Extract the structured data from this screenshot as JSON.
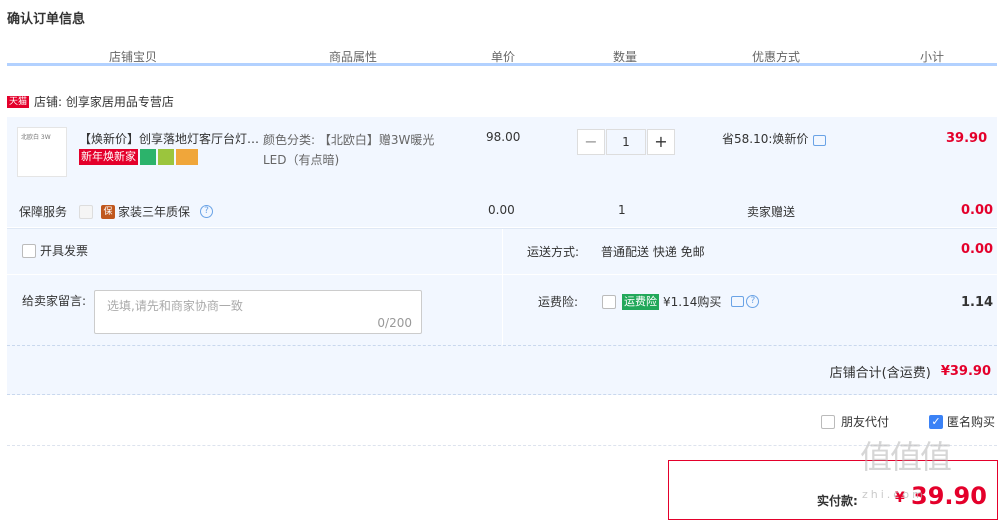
{
  "page_title": "确认订单信息",
  "table_headers": [
    "店铺宝贝",
    "商品属性",
    "单价",
    "数量",
    "优惠方式",
    "小计"
  ],
  "shop": {
    "badge": "天猫",
    "label": "店铺: 创享家居用品专营店"
  },
  "item": {
    "thumb_text": "北欧白 3W",
    "name": "【焕新价】创享落地灯客厅台灯…",
    "tag": "新年焕新家",
    "attr_line1": "颜色分类: 【北欧白】赠3W暖光",
    "attr_line2": "LED（有点暗)",
    "price": "98.00",
    "qty": "1",
    "minus": "−",
    "plus": "+",
    "promo": "省58.10:焕新价",
    "subtotal": "39.90"
  },
  "service": {
    "label": "保障服务",
    "badge": "保",
    "name": "家装三年质保",
    "help": "?",
    "price": "0.00",
    "qty": "1",
    "promo": "卖家赠送",
    "subtotal": "0.00"
  },
  "invoice_label": "开具发票",
  "shipping": {
    "label": "运送方式:",
    "value": "普通配送 快递 免邮",
    "amount": "0.00"
  },
  "message": {
    "label": "给卖家留言:",
    "placeholder": "选填,请先和商家协商一致",
    "counter": "0/200"
  },
  "insurance": {
    "label": "运费险:",
    "tag": "运费险",
    "value": "¥1.14购买",
    "help": "?",
    "amount": "1.14"
  },
  "shop_total": {
    "label": "店铺合计(含运费)",
    "value": "¥39.90"
  },
  "friend_pay": "朋友代付",
  "anonymous": "匿名购买",
  "anonymous_check": "✓",
  "pay": {
    "label": "实付款:",
    "symbol": "¥",
    "value": "39.90"
  },
  "watermark": {
    "main": "值值值",
    "sub": "zhi.com"
  },
  "colors": {
    "accent_red": "#e4002b",
    "header_line": "#b2d1ff",
    "row_bg": "#f2f7ff",
    "link_blue": "#6aa3e6"
  }
}
